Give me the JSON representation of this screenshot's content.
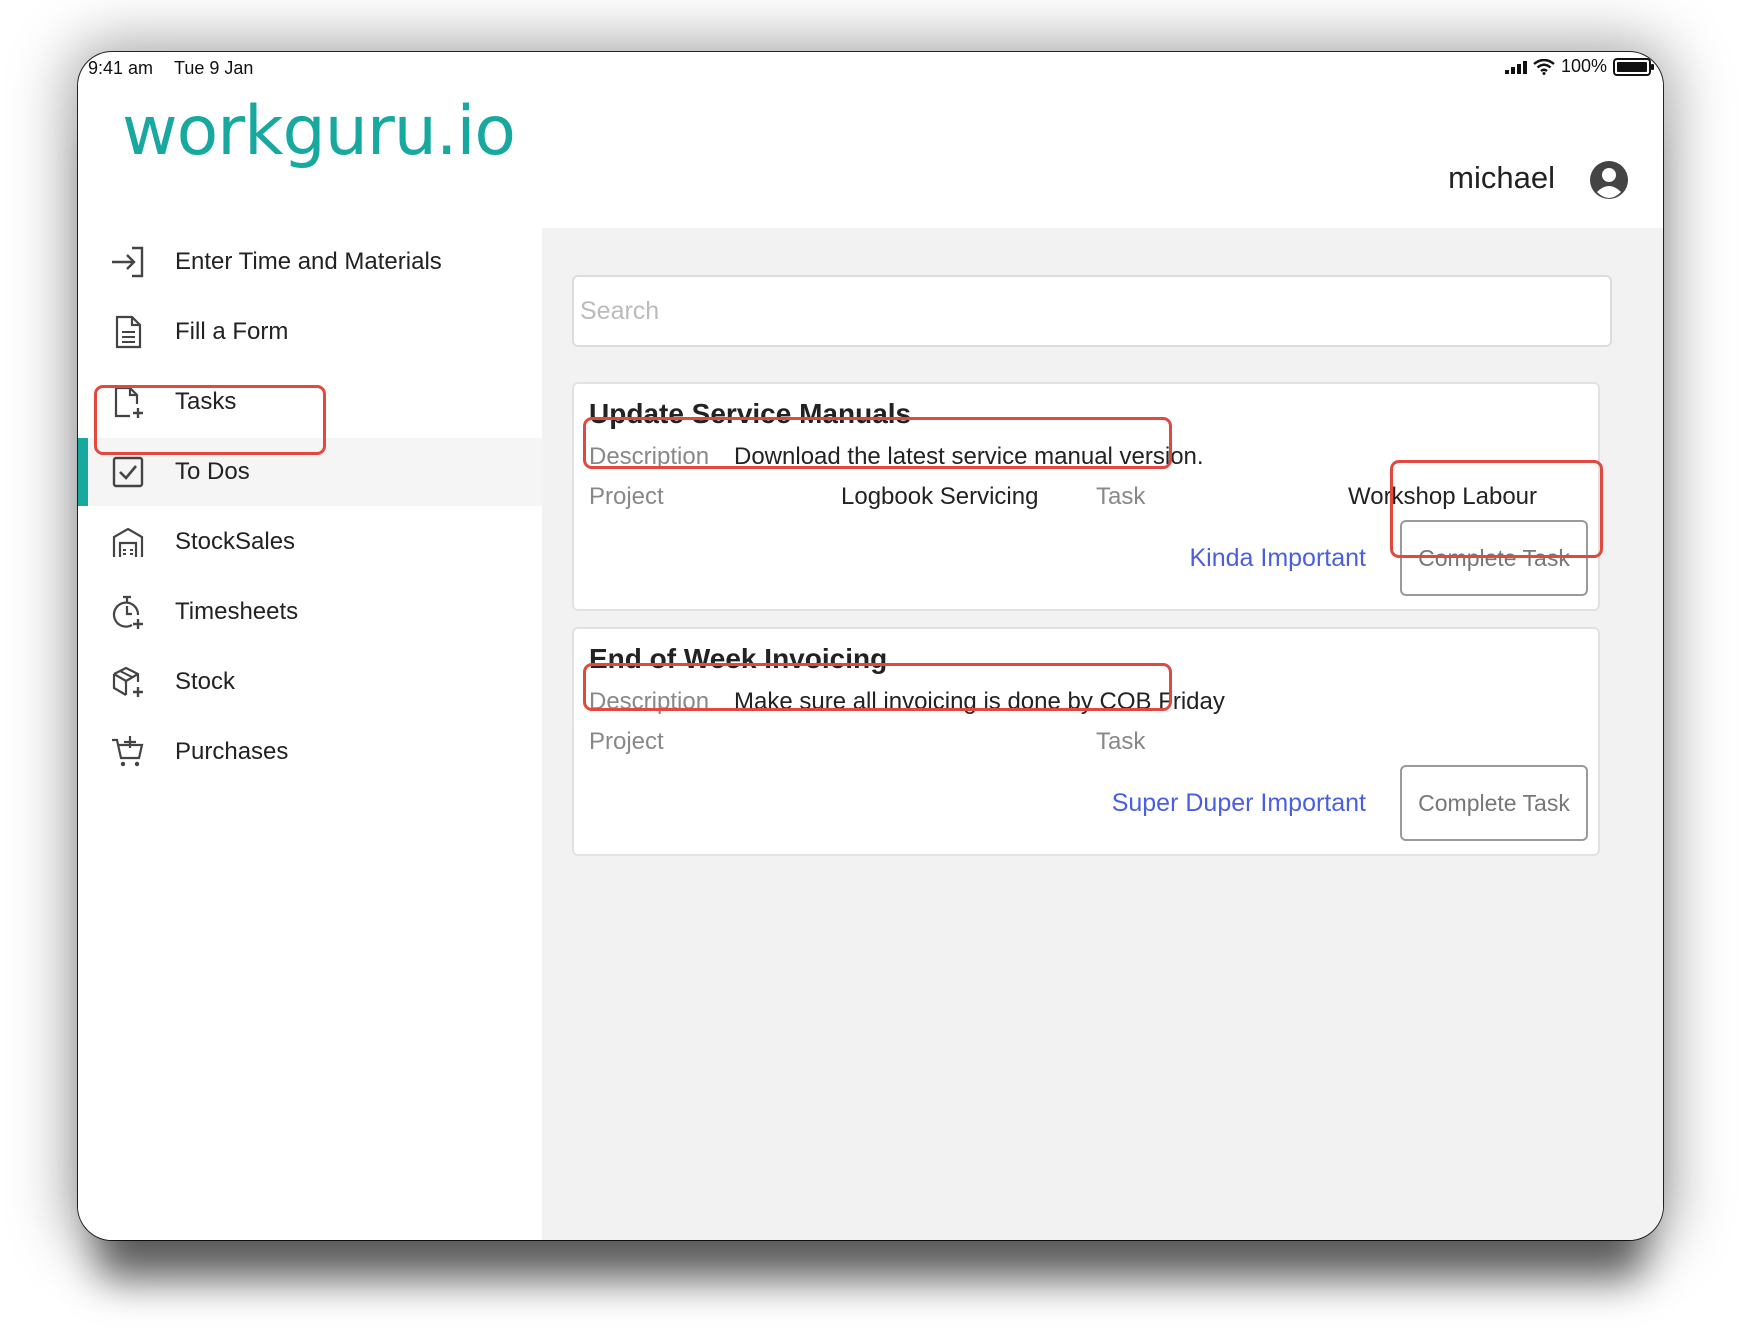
{
  "status_bar": {
    "time": "9:41 am",
    "date": "Tue 9 Jan",
    "battery": "100%"
  },
  "header": {
    "logo": "workguru.io",
    "username": "michael"
  },
  "sidebar": {
    "items": [
      {
        "label": "Enter Time and Materials",
        "icon": "enter-icon"
      },
      {
        "label": "Fill a Form",
        "icon": "form-icon"
      },
      {
        "label": "Tasks",
        "icon": "task-add-icon"
      },
      {
        "label": "To Dos",
        "icon": "checkbox-icon",
        "active": true
      },
      {
        "label": "StockSales",
        "icon": "store-icon"
      },
      {
        "label": "Timesheets",
        "icon": "stopwatch-icon"
      },
      {
        "label": "Stock",
        "icon": "package-icon"
      },
      {
        "label": "Purchases",
        "icon": "cart-icon"
      }
    ]
  },
  "search": {
    "placeholder": "Search",
    "value": ""
  },
  "todos": [
    {
      "title": "Update Service Manuals",
      "description_label": "Description",
      "description": "Download the latest service manual version.",
      "project_label": "Project",
      "project": "Logbook Servicing",
      "task_label": "Task",
      "task": "Workshop Labour",
      "priority": "Kinda Important",
      "button": "Complete Task"
    },
    {
      "title": "End of Week Invoicing",
      "description_label": "Description",
      "description": "Make sure all invoicing is done by COB Friday",
      "project_label": "Project",
      "project": "",
      "task_label": "Task",
      "task": "",
      "priority": "Super Duper Important",
      "button": "Complete Task"
    }
  ],
  "colors": {
    "brand": "#17a9a0",
    "priority_link": "#4a5fe0",
    "highlight": "#e2483d",
    "main_bg": "#f2f2f2"
  }
}
